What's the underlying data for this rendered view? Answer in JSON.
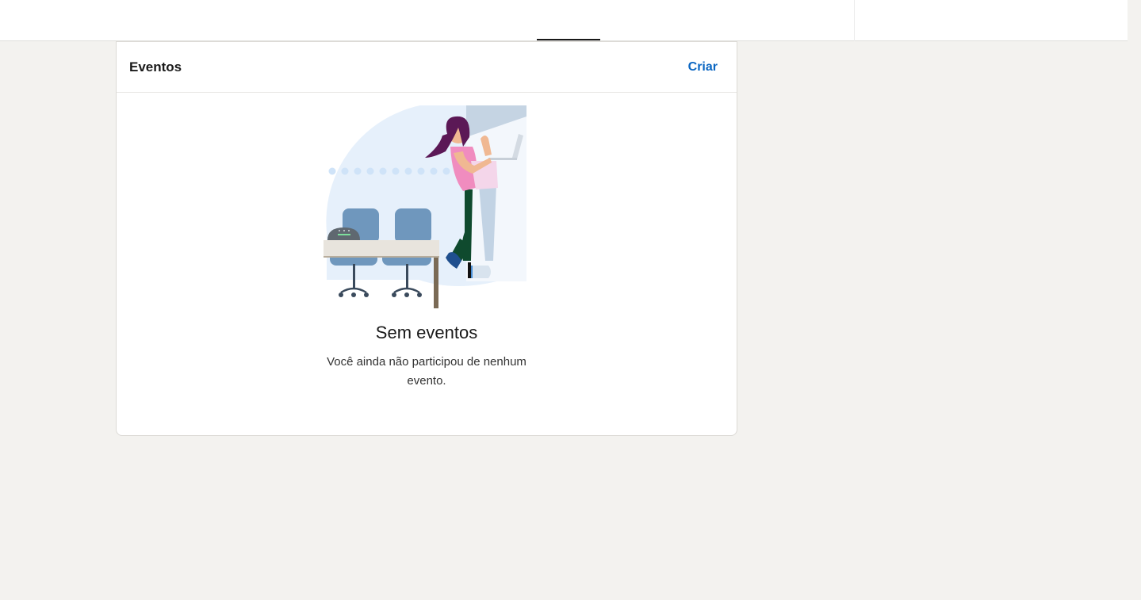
{
  "events": {
    "title": "Eventos",
    "create_label": "Criar",
    "empty_title": "Sem eventos",
    "empty_description": "Você ainda não participou de nenhum evento."
  },
  "colors": {
    "accent": "#0a66c2",
    "page_background": "#f3f2ef",
    "card_background": "#ffffff"
  },
  "icons": {
    "illustration": "empty-events-illustration"
  }
}
